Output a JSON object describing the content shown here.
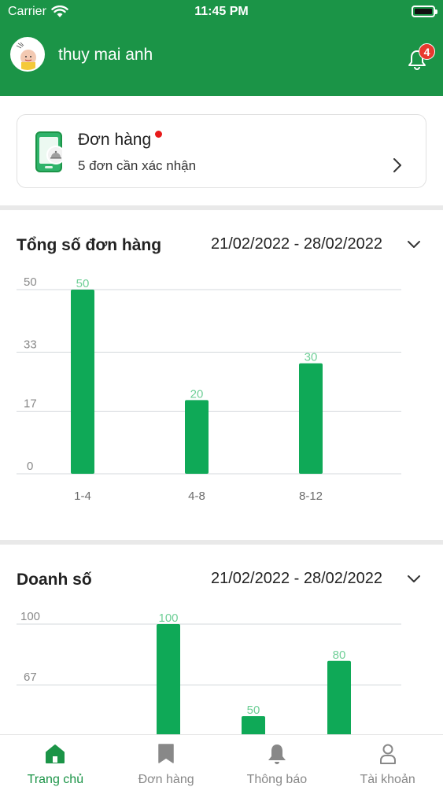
{
  "status_bar": {
    "carrier": "Carrier",
    "time": "11:45 PM"
  },
  "header": {
    "username": "thuy mai anh",
    "notification_count": "4"
  },
  "order_card": {
    "title": "Đơn hàng",
    "subtitle": "5 đơn cần xác nhận"
  },
  "sections": {
    "orders": {
      "title": "Tổng số đơn hàng",
      "date_range": "21/02/2022 - 28/02/2022"
    },
    "revenue": {
      "title": "Doanh số",
      "date_range": "21/02/2022 - 28/02/2022"
    }
  },
  "bottom_nav": {
    "items": [
      {
        "label": "Trang chủ",
        "icon": "home-icon",
        "active": true
      },
      {
        "label": "Đơn hàng",
        "icon": "bookmark-icon",
        "active": false
      },
      {
        "label": "Thông báo",
        "icon": "bell-icon",
        "active": false
      },
      {
        "label": "Tài khoản",
        "icon": "user-icon",
        "active": false
      }
    ]
  },
  "colors": {
    "brand": "#1b9447",
    "bar": "#0fa957",
    "bar_label": "#6fcf97",
    "badge": "#e8392f"
  },
  "chart_data": [
    {
      "type": "bar",
      "title": "Tổng số đơn hàng",
      "categories": [
        "1-4",
        "4-8",
        "8-12"
      ],
      "values": [
        50,
        20,
        30
      ],
      "y_ticks": [
        "0",
        "17",
        "33",
        "50"
      ],
      "ylim": [
        0,
        50
      ],
      "grid": true
    },
    {
      "type": "bar",
      "title": "Doanh số",
      "values": [
        100,
        50,
        80
      ],
      "y_ticks": [
        "67",
        "100"
      ],
      "ylim": [
        0,
        100
      ],
      "grid": true
    }
  ]
}
